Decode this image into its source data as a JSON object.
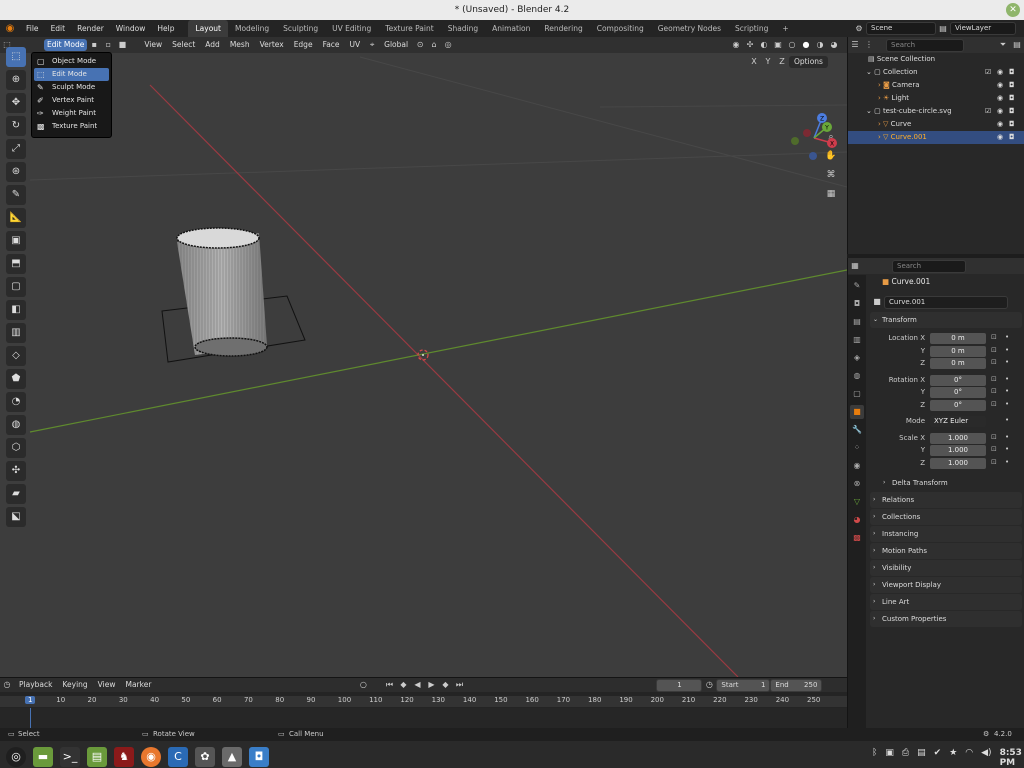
{
  "window": {
    "title": "* (Unsaved) - Blender 4.2",
    "close_label": "✕"
  },
  "menubar": {
    "items": [
      "File",
      "Edit",
      "Render",
      "Window",
      "Help"
    ]
  },
  "workspaces": [
    "Layout",
    "Modeling",
    "Sculpting",
    "UV Editing",
    "Texture Paint",
    "Shading",
    "Animation",
    "Rendering",
    "Compositing",
    "Geometry Nodes",
    "Scripting"
  ],
  "active_workspace": "Layout",
  "scene": {
    "label": "Scene",
    "view_layer": "ViewLayer"
  },
  "viewport_header": {
    "mode": "Edit Mode",
    "menus": [
      "View",
      "Select",
      "Add",
      "Mesh",
      "Vertex",
      "Edge",
      "Face",
      "UV"
    ],
    "orientation": "Global",
    "options_label": "Options",
    "axes": [
      "X",
      "Y",
      "Z"
    ]
  },
  "mode_menu": {
    "items": [
      "Object Mode",
      "Edit Mode",
      "Sculpt Mode",
      "Vertex Paint",
      "Weight Paint",
      "Texture Paint"
    ],
    "selected": "Edit Mode"
  },
  "outliner": {
    "search_placeholder": "Search",
    "rows": [
      {
        "label": "Scene Collection",
        "depth": 0
      },
      {
        "label": "Collection",
        "depth": 1
      },
      {
        "label": "Camera",
        "depth": 2
      },
      {
        "label": "Light",
        "depth": 2
      },
      {
        "label": "test-cube-circle.svg",
        "depth": 1
      },
      {
        "label": "Curve",
        "depth": 2
      },
      {
        "label": "Curve.001",
        "depth": 2,
        "selected": true
      }
    ]
  },
  "properties": {
    "search_placeholder": "Search",
    "object_name": "Curve.001",
    "object_field": "Curve.001",
    "transform_label": "Transform",
    "location_label": "Location X",
    "location": [
      "0 m",
      "0 m",
      "0 m"
    ],
    "rotation_label": "Rotation X",
    "rotation": [
      "0°",
      "0°",
      "0°"
    ],
    "mode_label": "Mode",
    "rotation_mode": "XYZ Euler",
    "scale_label": "Scale X",
    "scale": [
      "1.000",
      "1.000",
      "1.000"
    ],
    "axis_y": "Y",
    "axis_z": "Z",
    "delta_transform": "Delta Transform",
    "panels": [
      "Relations",
      "Collections",
      "Instancing",
      "Motion Paths",
      "Visibility",
      "Viewport Display",
      "Line Art",
      "Custom Properties"
    ]
  },
  "timeline": {
    "menus": [
      "Playback",
      "Keying",
      "View",
      "Marker"
    ],
    "current_frame": "1",
    "start_label": "Start",
    "start": "1",
    "end_label": "End",
    "end": "250",
    "ticks": [
      "1",
      "10",
      "20",
      "30",
      "40",
      "50",
      "60",
      "70",
      "80",
      "90",
      "100",
      "110",
      "120",
      "130",
      "140",
      "150",
      "160",
      "170",
      "180",
      "190",
      "200",
      "210",
      "220",
      "230",
      "240",
      "250"
    ]
  },
  "statusbar": {
    "select": "Select",
    "rotate": "Rotate View",
    "call_menu": "Call Menu",
    "version": "4.2.0"
  },
  "taskbar": {
    "time": "8:53 PM"
  }
}
